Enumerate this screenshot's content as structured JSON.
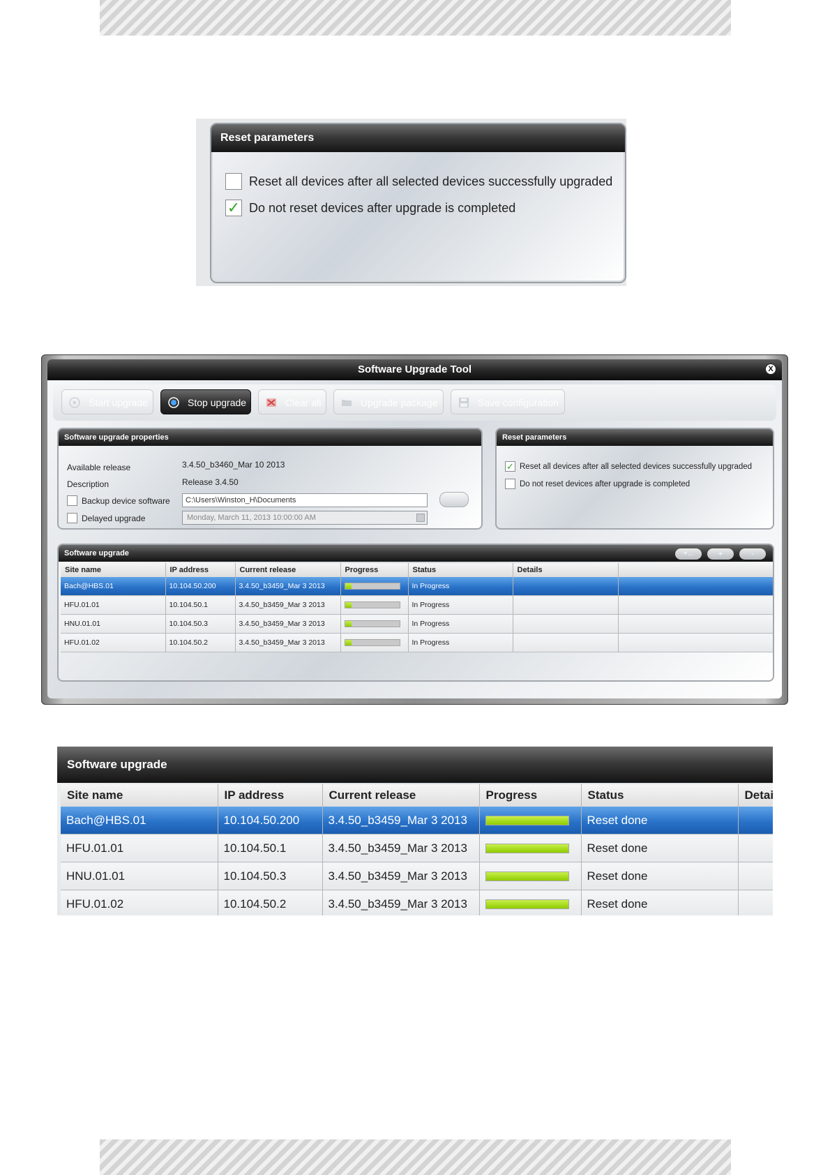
{
  "reset_params_large": {
    "title": "Reset parameters",
    "options": [
      {
        "label": "Reset all devices after all selected devices successfully upgraded",
        "checked": false
      },
      {
        "label": "Do not reset devices after upgrade is completed",
        "checked": true
      }
    ]
  },
  "tool": {
    "title": "Software Upgrade Tool",
    "close_glyph": "X",
    "toolbar": {
      "start": "Start upgrade",
      "stop": "Stop upgrade",
      "clear": "Clear all",
      "package": "Upgrade package",
      "save": "Save configuration"
    },
    "properties": {
      "title": "Software upgrade properties",
      "available_release_label": "Available release",
      "available_release_value": "3.4.50_b3460_Mar 10 2013",
      "description_label": "Description",
      "description_value": "Release 3.4.50",
      "backup_label": "Backup device software",
      "backup_path": "C:\\Users\\Winston_H\\Documents",
      "delayed_label": "Delayed upgrade",
      "delayed_value": "Monday, March 11, 2013 10:00:00 AM"
    },
    "reset_params": {
      "title": "Reset parameters",
      "options": [
        {
          "label": "Reset all devices after all selected devices successfully upgraded",
          "checked": true
        },
        {
          "label": "Do not reset devices after upgrade is completed",
          "checked": false
        }
      ]
    },
    "software_upgrade": {
      "title": "Software upgrade",
      "header_buttons": [
        "+...",
        "+",
        "-"
      ],
      "columns": [
        "Site name",
        "IP address",
        "Current release",
        "Progress",
        "Status",
        "Details",
        ""
      ],
      "rows": [
        {
          "site": "Bach@HBS.01",
          "ip": "10.104.50.200",
          "release": "3.4.50_b3459_Mar  3 2013",
          "progress": 0.12,
          "status": "In Progress",
          "details": "",
          "selected": true
        },
        {
          "site": "HFU.01.01",
          "ip": "10.104.50.1",
          "release": "3.4.50_b3459_Mar  3 2013",
          "progress": 0.12,
          "status": "In Progress",
          "details": "",
          "selected": false
        },
        {
          "site": "HNU.01.01",
          "ip": "10.104.50.3",
          "release": "3.4.50_b3459_Mar  3 2013",
          "progress": 0.12,
          "status": "In Progress",
          "details": "",
          "selected": false
        },
        {
          "site": "HFU.01.02",
          "ip": "10.104.50.2",
          "release": "3.4.50_b3459_Mar  3 2013",
          "progress": 0.12,
          "status": "In Progress",
          "details": "",
          "selected": false
        }
      ]
    }
  },
  "software_upgrade_large": {
    "title": "Software upgrade",
    "columns": [
      "Site name",
      "IP address",
      "Current release",
      "Progress",
      "Status",
      "Detai"
    ],
    "rows": [
      {
        "site": "Bach@HBS.01",
        "ip": "10.104.50.200",
        "release": "3.4.50_b3459_Mar  3 2013",
        "progress": 1.0,
        "status": "Reset done",
        "selected": true
      },
      {
        "site": "HFU.01.01",
        "ip": "10.104.50.1",
        "release": "3.4.50_b3459_Mar  3 2013",
        "progress": 1.0,
        "status": "Reset done",
        "selected": false
      },
      {
        "site": "HNU.01.01",
        "ip": "10.104.50.3",
        "release": "3.4.50_b3459_Mar  3 2013",
        "progress": 1.0,
        "status": "Reset done",
        "selected": false
      },
      {
        "site": "HFU.01.02",
        "ip": "10.104.50.2",
        "release": "3.4.50_b3459_Mar  3 2013",
        "progress": 1.0,
        "status": "Reset done",
        "selected": false
      }
    ]
  }
}
